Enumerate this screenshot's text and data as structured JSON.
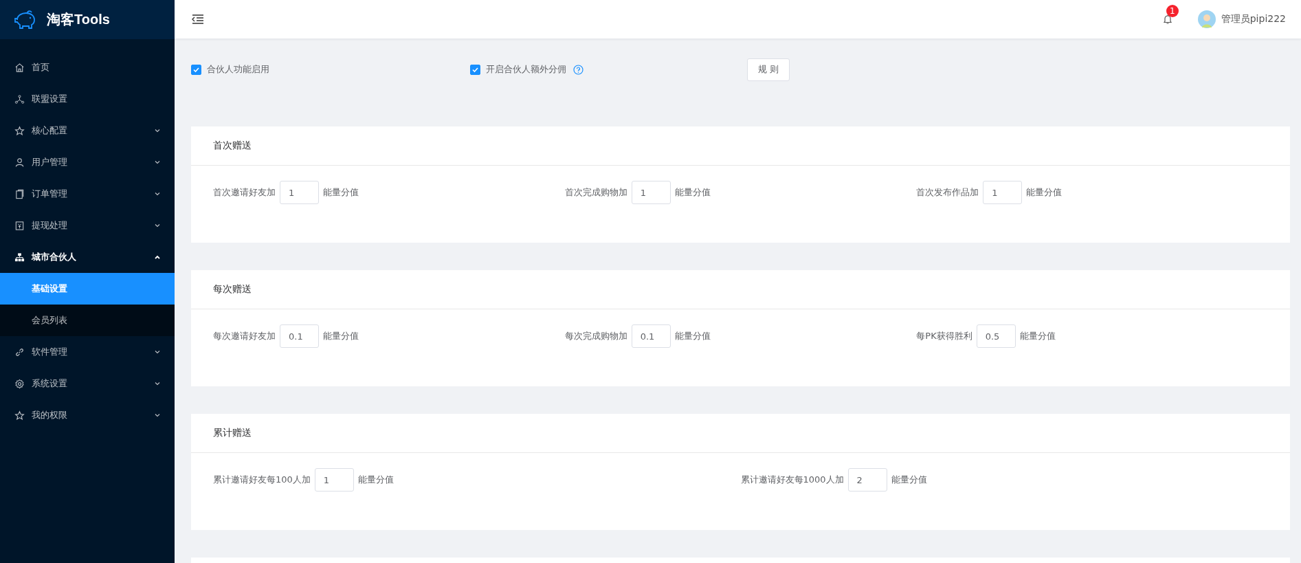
{
  "brand": {
    "title": "淘客Tools"
  },
  "sidebar": {
    "items": [
      {
        "kind": "link",
        "label": "首页"
      },
      {
        "kind": "link",
        "label": "联盟设置"
      },
      {
        "kind": "submenu",
        "label": "核心配置",
        "expanded": false
      },
      {
        "kind": "submenu",
        "label": "用户管理",
        "expanded": false
      },
      {
        "kind": "submenu",
        "label": "订单管理",
        "expanded": false
      },
      {
        "kind": "submenu",
        "label": "提现处理",
        "expanded": false
      },
      {
        "kind": "submenu",
        "label": "城市合伙人",
        "expanded": true,
        "children": [
          {
            "label": "基础设置",
            "selected": true
          },
          {
            "label": "会员列表",
            "selected": false
          }
        ]
      },
      {
        "kind": "submenu",
        "label": "软件管理",
        "expanded": false
      },
      {
        "kind": "submenu",
        "label": "系统设置",
        "expanded": false
      },
      {
        "kind": "submenu",
        "label": "我的权限",
        "expanded": false
      }
    ]
  },
  "header": {
    "notification_count": "1",
    "user": "管理员pipi222"
  },
  "options": [
    {
      "kind": "plain",
      "label": "合伙人功能启用",
      "checked": true
    },
    {
      "kind": "with-help",
      "label": "开启合伙人额外分佣",
      "checked": true
    }
  ],
  "rules_button": "规 则",
  "sections": [
    {
      "title": "首次赠送",
      "fields": [
        {
          "label": "首次邀请好友加",
          "value": "1",
          "unit": "能量分值"
        },
        {
          "label": "首次完成购物加",
          "value": "1",
          "unit": "能量分值"
        },
        {
          "label": "首次发布作品加",
          "value": "1",
          "unit": "能量分值"
        }
      ]
    },
    {
      "title": "每次赠送",
      "fields": [
        {
          "label": "每次邀请好友加",
          "value": "0.1",
          "unit": "能量分值"
        },
        {
          "label": "每次完成购物加",
          "value": "0.1",
          "unit": "能量分值"
        },
        {
          "label": "每PK获得胜利",
          "value": "0.5",
          "unit": "能量分值"
        }
      ]
    },
    {
      "title": "累计赠送",
      "fields": [
        {
          "label": "累计邀请好友每100人加",
          "value": "1",
          "unit": "能量分值"
        },
        {
          "label": "累计邀请好友每1000人加",
          "value": "2",
          "unit": "能量分值"
        }
      ]
    }
  ]
}
